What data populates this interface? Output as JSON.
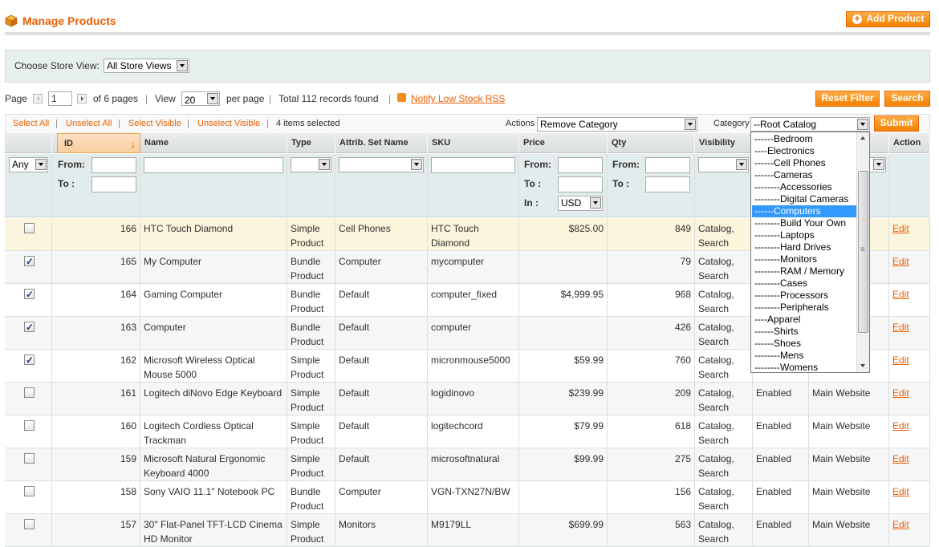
{
  "header": {
    "title": "Manage Products",
    "add_label": "Add Product"
  },
  "store": {
    "label": "Choose Store View:",
    "value": "All Store Views"
  },
  "pager": {
    "page_label": "Page",
    "page_value": "1",
    "of_pages": "of 6 pages",
    "view_label": "View",
    "per_page_value": "20",
    "per_page_label": "per page",
    "total": "Total 112 records found",
    "rss_label": "Notify Low Stock RSS"
  },
  "buttons": {
    "reset": "Reset Filter",
    "search": "Search",
    "submit": "Submit"
  },
  "massaction": {
    "select_all": "Select All",
    "unselect_all": "Unselect All",
    "select_visible": "Select Visible",
    "unselect_visible": "Unselect Visible",
    "selected": "4 items selected",
    "actions_label": "Actions",
    "actions_value": "Remove Category",
    "category_label": "Category",
    "category_value": "--Root Catalog"
  },
  "columns": [
    "ID",
    "Name",
    "Type",
    "Attrib. Set Name",
    "SKU",
    "Price",
    "Qty",
    "Visibility",
    "Action"
  ],
  "filters": {
    "any": "Any",
    "from": "From:",
    "to": "To :",
    "in": "In :",
    "currency": "USD"
  },
  "category_options": [
    "------Bedroom",
    "----Electronics",
    "------Cell Phones",
    "------Cameras",
    "--------Accessories",
    "--------Digital Cameras",
    "------Computers",
    "--------Build Your Own",
    "--------Laptops",
    "--------Hard Drives",
    "--------Monitors",
    "--------RAM / Memory",
    "--------Cases",
    "--------Processors",
    "--------Peripherals",
    "----Apparel",
    "------Shirts",
    "------Shoes",
    "--------Mens",
    "--------Womens"
  ],
  "rows": [
    {
      "checked": false,
      "id": "166",
      "name": "HTC Touch Diamond",
      "type": "Simple Product",
      "attr": "Cell Phones",
      "sku": "HTC Touch Diamond",
      "price": "$825.00",
      "qty": "849",
      "visibility": "Catalog, Search",
      "status": "",
      "website": "",
      "action": "Edit"
    },
    {
      "checked": true,
      "id": "165",
      "name": "My Computer",
      "type": "Bundle Product",
      "attr": "Computer",
      "sku": "mycomputer",
      "price": "",
      "qty": "79",
      "visibility": "Catalog, Search",
      "status": "",
      "website": "",
      "action": "Edit"
    },
    {
      "checked": true,
      "id": "164",
      "name": "Gaming Computer",
      "type": "Bundle Product",
      "attr": "Default",
      "sku": "computer_fixed",
      "price": "$4,999.95",
      "qty": "968",
      "visibility": "Catalog, Search",
      "status": "",
      "website": "",
      "action": "Edit"
    },
    {
      "checked": true,
      "id": "163",
      "name": "Computer",
      "type": "Bundle Product",
      "attr": "Default",
      "sku": "computer",
      "price": "",
      "qty": "426",
      "visibility": "Catalog, Search",
      "status": "",
      "website": "",
      "action": "Edit"
    },
    {
      "checked": true,
      "id": "162",
      "name": "Microsoft Wireless Optical Mouse 5000",
      "type": "Simple Product",
      "attr": "Default",
      "sku": "micronmouse5000",
      "price": "$59.99",
      "qty": "760",
      "visibility": "Catalog, Search",
      "status": "",
      "website": "",
      "action": "Edit"
    },
    {
      "checked": false,
      "id": "161",
      "name": "Logitech diNovo Edge Keyboard",
      "type": "Simple Product",
      "attr": "Default",
      "sku": "logidinovo",
      "price": "$239.99",
      "qty": "209",
      "visibility": "Catalog, Search",
      "status": "Enabled",
      "website": "Main Website",
      "action": "Edit"
    },
    {
      "checked": false,
      "id": "160",
      "name": "Logitech Cordless Optical Trackman",
      "type": "Simple Product",
      "attr": "Default",
      "sku": "logitechcord",
      "price": "$79.99",
      "qty": "618",
      "visibility": "Catalog, Search",
      "status": "Enabled",
      "website": "Main Website",
      "action": "Edit"
    },
    {
      "checked": false,
      "id": "159",
      "name": "Microsoft Natural Ergonomic Keyboard 4000",
      "type": "Simple Product",
      "attr": "Default",
      "sku": "microsoftnatural",
      "price": "$99.99",
      "qty": "275",
      "visibility": "Catalog, Search",
      "status": "Enabled",
      "website": "Main Website",
      "action": "Edit"
    },
    {
      "checked": false,
      "id": "158",
      "name": "Sony VAIO 11.1\" Notebook PC",
      "type": "Bundle Product",
      "attr": "Computer",
      "sku": "VGN-TXN27N/BW",
      "price": "",
      "qty": "156",
      "visibility": "Catalog, Search",
      "status": "Enabled",
      "website": "Main Website",
      "action": "Edit"
    },
    {
      "checked": false,
      "id": "157",
      "name": "30\" Flat-Panel TFT-LCD Cinema HD Monitor",
      "type": "Simple Product",
      "attr": "Monitors",
      "sku": "M9179LL",
      "price": "$699.99",
      "qty": "563",
      "visibility": "Catalog, Search",
      "status": "Enabled",
      "website": "Main Website",
      "action": "Edit"
    }
  ]
}
